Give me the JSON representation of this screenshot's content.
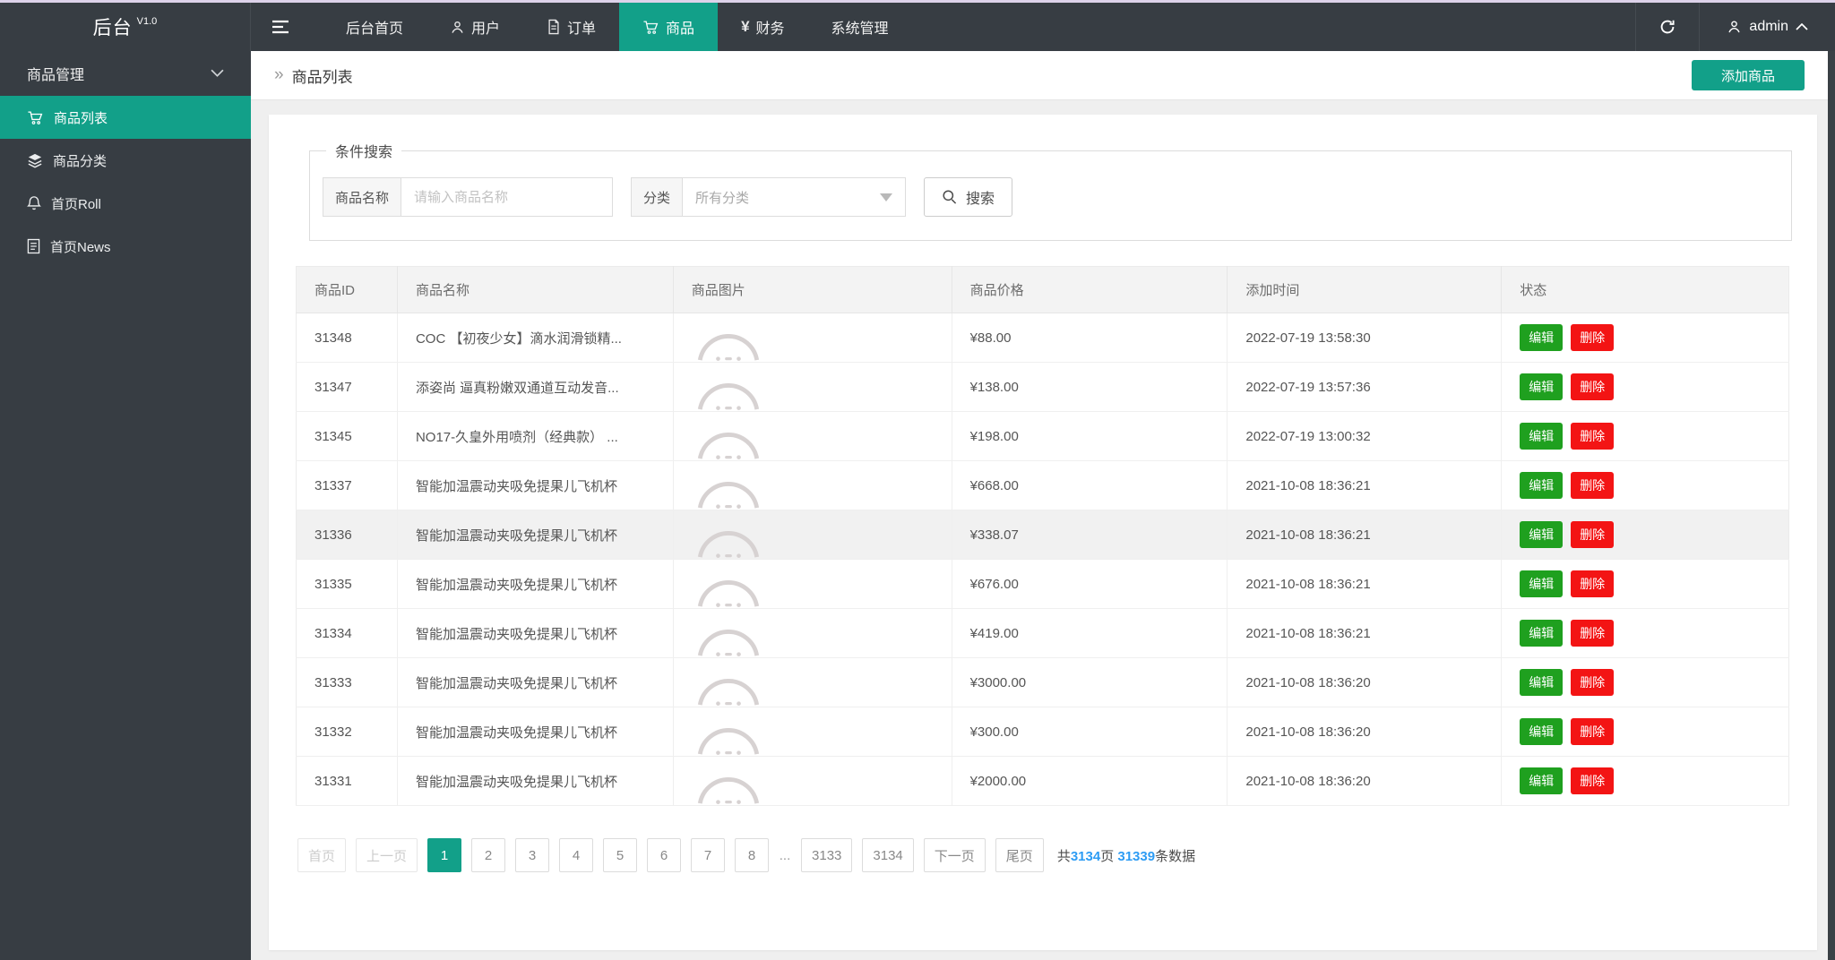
{
  "colors": {
    "accent": "#12A089",
    "dark": "#373D43",
    "green": "#1FA01F",
    "red": "#F31414",
    "blue": "#2D9CF4"
  },
  "topbar": {
    "logo": "后台",
    "version": "V1.0",
    "nav": [
      {
        "name": "home",
        "label": "后台首页",
        "icon": null,
        "active": false
      },
      {
        "name": "users",
        "label": "用户",
        "icon": "user",
        "active": false
      },
      {
        "name": "orders",
        "label": "订单",
        "icon": "order",
        "active": false
      },
      {
        "name": "goods",
        "label": "商品",
        "icon": "cart",
        "active": true
      },
      {
        "name": "finance",
        "label": "财务",
        "icon": "yen",
        "active": false
      },
      {
        "name": "system",
        "label": "系统管理",
        "icon": null,
        "active": false
      }
    ],
    "admin_label": "admin"
  },
  "sidebar": {
    "group_label": "商品管理",
    "items": [
      {
        "name": "goods-list",
        "label": "商品列表",
        "icon": "cart",
        "active": true
      },
      {
        "name": "goods-category",
        "label": "商品分类",
        "icon": "layers",
        "active": false
      },
      {
        "name": "home-roll",
        "label": "首页Roll",
        "icon": "bell",
        "active": false
      },
      {
        "name": "home-news",
        "label": "首页News",
        "icon": "news",
        "active": false
      }
    ]
  },
  "breadcrumb": {
    "caret": "»",
    "title": "商品列表",
    "add_button": "添加商品"
  },
  "search": {
    "legend": "条件搜索",
    "name_label": "商品名称",
    "name_placeholder": "请输入商品名称",
    "category_label": "分类",
    "category_value": "所有分类",
    "button_label": "搜索"
  },
  "table": {
    "columns": [
      "商品ID",
      "商品名称",
      "商品图片",
      "商品价格",
      "添加时间",
      "状态"
    ],
    "edit_label": "编辑",
    "delete_label": "删除",
    "rows": [
      {
        "id": "31348",
        "name": "COC 【初夜少女】滴水润滑锁精...",
        "price": "¥88.00",
        "time": "2022-07-19 13:58:30",
        "highlighted": false
      },
      {
        "id": "31347",
        "name": "添姿尚 逼真粉嫩双通道互动发音...",
        "price": "¥138.00",
        "time": "2022-07-19 13:57:36",
        "highlighted": false
      },
      {
        "id": "31345",
        "name": "NO17-久皇外用喷剂（经典款） ...",
        "price": "¥198.00",
        "time": "2022-07-19 13:00:32",
        "highlighted": false
      },
      {
        "id": "31337",
        "name": "智能加温震动夹吸免提果儿飞机杯",
        "price": "¥668.00",
        "time": "2021-10-08 18:36:21",
        "highlighted": false
      },
      {
        "id": "31336",
        "name": "智能加温震动夹吸免提果儿飞机杯",
        "price": "¥338.07",
        "time": "2021-10-08 18:36:21",
        "highlighted": true
      },
      {
        "id": "31335",
        "name": "智能加温震动夹吸免提果儿飞机杯",
        "price": "¥676.00",
        "time": "2021-10-08 18:36:21",
        "highlighted": false
      },
      {
        "id": "31334",
        "name": "智能加温震动夹吸免提果儿飞机杯",
        "price": "¥419.00",
        "time": "2021-10-08 18:36:21",
        "highlighted": false
      },
      {
        "id": "31333",
        "name": "智能加温震动夹吸免提果儿飞机杯",
        "price": "¥3000.00",
        "time": "2021-10-08 18:36:20",
        "highlighted": false
      },
      {
        "id": "31332",
        "name": "智能加温震动夹吸免提果儿飞机杯",
        "price": "¥300.00",
        "time": "2021-10-08 18:36:20",
        "highlighted": false
      },
      {
        "id": "31331",
        "name": "智能加温震动夹吸免提果儿飞机杯",
        "price": "¥2000.00",
        "time": "2021-10-08 18:36:20",
        "highlighted": false
      }
    ]
  },
  "pagination": {
    "items": [
      {
        "label": "首页",
        "state": "disabled"
      },
      {
        "label": "上一页",
        "state": "disabled"
      },
      {
        "label": "1",
        "state": "active"
      },
      {
        "label": "2",
        "state": "normal"
      },
      {
        "label": "3",
        "state": "normal"
      },
      {
        "label": "4",
        "state": "normal"
      },
      {
        "label": "5",
        "state": "normal"
      },
      {
        "label": "6",
        "state": "normal"
      },
      {
        "label": "7",
        "state": "normal"
      },
      {
        "label": "8",
        "state": "normal"
      },
      {
        "label": "...",
        "state": "ellipsis"
      },
      {
        "label": "3133",
        "state": "normal"
      },
      {
        "label": "3134",
        "state": "normal"
      },
      {
        "label": "下一页",
        "state": "normal"
      },
      {
        "label": "尾页",
        "state": "normal"
      }
    ],
    "summary": {
      "prefix": "共",
      "pages": "3134",
      "mid": "页 ",
      "count": "31339",
      "suffix": "条数据"
    }
  }
}
